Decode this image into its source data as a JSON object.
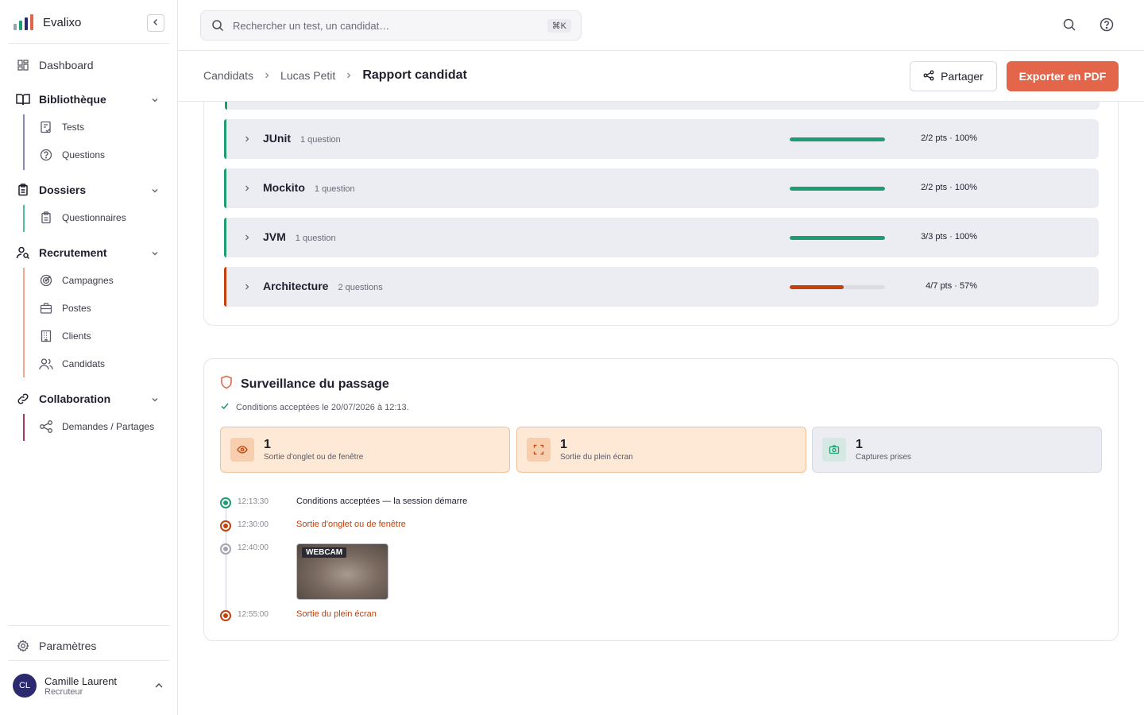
{
  "app": {
    "name": "Evalixo"
  },
  "sidebar": {
    "dashboard": "Dashboard",
    "bibliotheque": {
      "label": "Bibliothèque",
      "items": [
        "Tests",
        "Questions"
      ]
    },
    "dossiers": {
      "label": "Dossiers",
      "items": [
        "Questionnaires"
      ]
    },
    "recrutement": {
      "label": "Recrutement",
      "items": [
        "Campagnes",
        "Postes",
        "Clients",
        "Candidats"
      ]
    },
    "collaboration": {
      "label": "Collaboration",
      "items": [
        "Demandes / Partages"
      ]
    },
    "settings": "Paramètres",
    "user": {
      "initials": "CL",
      "name": "Camille Laurent",
      "role": "Recruteur"
    }
  },
  "search": {
    "placeholder": "Rechercher un test, un candidat…",
    "shortcut": "⌘K"
  },
  "breadcrumb": {
    "c1": "Candidats",
    "c2": "Lucas Petit",
    "current": "Rapport candidat"
  },
  "actions": {
    "share": "Partager",
    "export": "Exporter en PDF"
  },
  "categories": [
    {
      "name": "JUnit",
      "questions": "1 question",
      "score": "2/2 pts · 100%",
      "ratio": 1.0,
      "color": "#1f9d72"
    },
    {
      "name": "Mockito",
      "questions": "1 question",
      "score": "2/2 pts · 100%",
      "ratio": 1.0,
      "color": "#1f9d72"
    },
    {
      "name": "JVM",
      "questions": "1 question",
      "score": "3/3 pts · 100%",
      "ratio": 1.0,
      "color": "#1f9d72"
    },
    {
      "name": "Architecture",
      "questions": "2 questions",
      "score": "4/7 pts · 57%",
      "ratio": 0.57,
      "color": "#c2410c"
    }
  ],
  "surveillance": {
    "title": "Surveillance du passage",
    "conditions": "Conditions acceptées le 20/07/2026 à 12:13.",
    "stats": [
      {
        "value": "1",
        "label": "Sortie d'onglet ou de fenêtre"
      },
      {
        "value": "1",
        "label": "Sortie du plein écran"
      },
      {
        "value": "1",
        "label": "Captures prises"
      }
    ],
    "timeline": [
      {
        "time": "12:13:30",
        "text": "Conditions acceptées — la session démarre"
      },
      {
        "time": "12:30:00",
        "text": "Sortie d'onglet ou de fenêtre"
      },
      {
        "time": "12:40:00",
        "text": "WEBCAM"
      },
      {
        "time": "12:55:00",
        "text": "Sortie du plein écran"
      }
    ]
  },
  "colors": {
    "accent": "#e4664a",
    "success": "#1f9d72",
    "danger": "#c2410c",
    "warnBg": "#fde9d5",
    "neutralBg": "#ececf3"
  }
}
